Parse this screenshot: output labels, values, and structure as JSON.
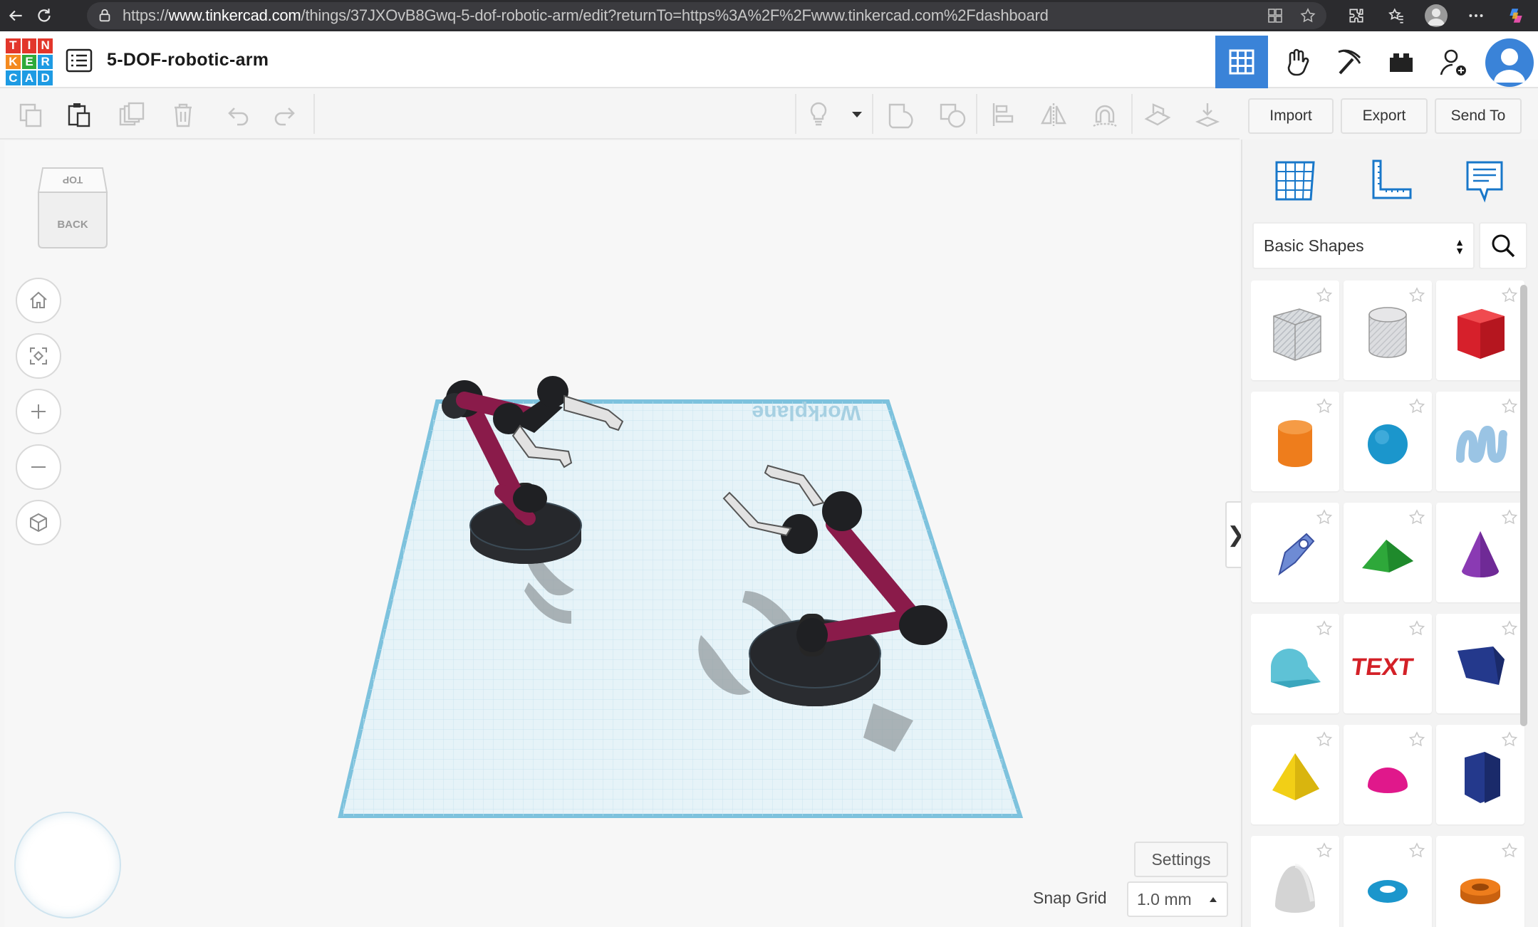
{
  "browser": {
    "url_prefix": "https://",
    "url_domain": "www.tinkercad.com",
    "url_path": "/things/37JXOvB8Gwq-5-dof-robotic-arm/edit?returnTo=https%3A%2F%2Fwww.tinkercad.com%2Fdashboard"
  },
  "header": {
    "logo_letters": [
      "T",
      "I",
      "N",
      "K",
      "E",
      "R",
      "C",
      "A",
      "D"
    ],
    "logo_colors": [
      "#e2362b",
      "#e2362b",
      "#e2362b",
      "#f48a1f",
      "#f48a1f",
      "#f48a1f",
      "#1e9be3",
      "#1e9be3",
      "#1e9be3"
    ],
    "design_title": "5-DOF-robotic-arm",
    "accent_color": "#3a83d8"
  },
  "actions": {
    "import_label": "Import",
    "export_label": "Export",
    "send_to_label": "Send To"
  },
  "viewcube": {
    "top_label": "TOP",
    "back_label": "BACK"
  },
  "workplane": {
    "label": "Workplane"
  },
  "canvas": {
    "settings_label": "Settings",
    "snap_grid_label": "Snap Grid",
    "snap_grid_value": "1.0 mm"
  },
  "panel": {
    "category_value": "Basic Shapes",
    "shapes": [
      {
        "name": "box-hole",
        "color": "#b8bcc2"
      },
      {
        "name": "cylinder-hole",
        "color": "#c2c4c8"
      },
      {
        "name": "box",
        "color": "#d6202b"
      },
      {
        "name": "cylinder",
        "color": "#ee7d1c"
      },
      {
        "name": "sphere",
        "color": "#1b96cc"
      },
      {
        "name": "scribble",
        "color": "#9ac4e4"
      },
      {
        "name": "shape-generator",
        "color": "#6e8bd4"
      },
      {
        "name": "roof",
        "color": "#2ea83a"
      },
      {
        "name": "cone",
        "color": "#8a3ab3"
      },
      {
        "name": "round-roof",
        "color": "#5ec2d6"
      },
      {
        "name": "text",
        "color": "#d32027"
      },
      {
        "name": "wedge",
        "color": "#24398c"
      },
      {
        "name": "pyramid",
        "color": "#f2cf16"
      },
      {
        "name": "half-sphere",
        "color": "#e0188b"
      },
      {
        "name": "polygon",
        "color": "#24398c"
      },
      {
        "name": "paraboloid",
        "color": "#d4d4d4"
      },
      {
        "name": "torus",
        "color": "#1b96cc"
      },
      {
        "name": "tube",
        "color": "#ee7d1c"
      }
    ]
  }
}
